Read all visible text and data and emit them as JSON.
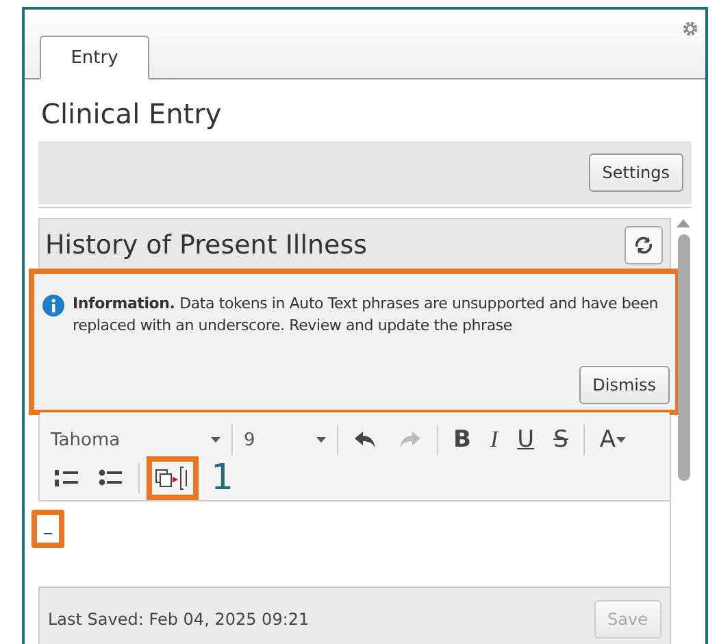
{
  "tabs": [
    {
      "label": "Entry",
      "selected": true
    }
  ],
  "title": "Clinical Entry",
  "settings_button": "Settings",
  "section": {
    "title": "History of Present Illness",
    "banner": {
      "heading": "Information.",
      "message": "Data tokens in Auto Text phrases are unsupported and have been replaced with an underscore. Review and update the phrase",
      "button": "Dismiss",
      "highlighted": true
    },
    "toolbar": {
      "font": "Tahoma",
      "size": "9",
      "buttons": [
        {
          "kind": "undo",
          "disabled": false
        },
        {
          "kind": "redo",
          "disabled": true
        },
        {
          "kind": "bold",
          "label": "B",
          "disabled": false
        },
        {
          "kind": "italic",
          "label": "I",
          "disabled": false
        },
        {
          "kind": "underline",
          "label": "U",
          "disabled": false
        },
        {
          "kind": "strike",
          "label": "S",
          "disabled": false
        },
        {
          "kind": "color",
          "label": "A",
          "disabled": false
        }
      ],
      "row2": [
        {
          "kind": "numbered",
          "highlighted": false
        },
        {
          "kind": "bulleted",
          "highlighted": false
        },
        {
          "kind": "token",
          "highlighted": true
        }
      ],
      "callout": "1"
    },
    "editor": {
      "text": "_",
      "highlighted": true
    },
    "footer": {
      "last_saved": "Last Saved: Feb 04, 2025 09:21",
      "save_button": "Save",
      "save_disabled": true
    }
  }
}
